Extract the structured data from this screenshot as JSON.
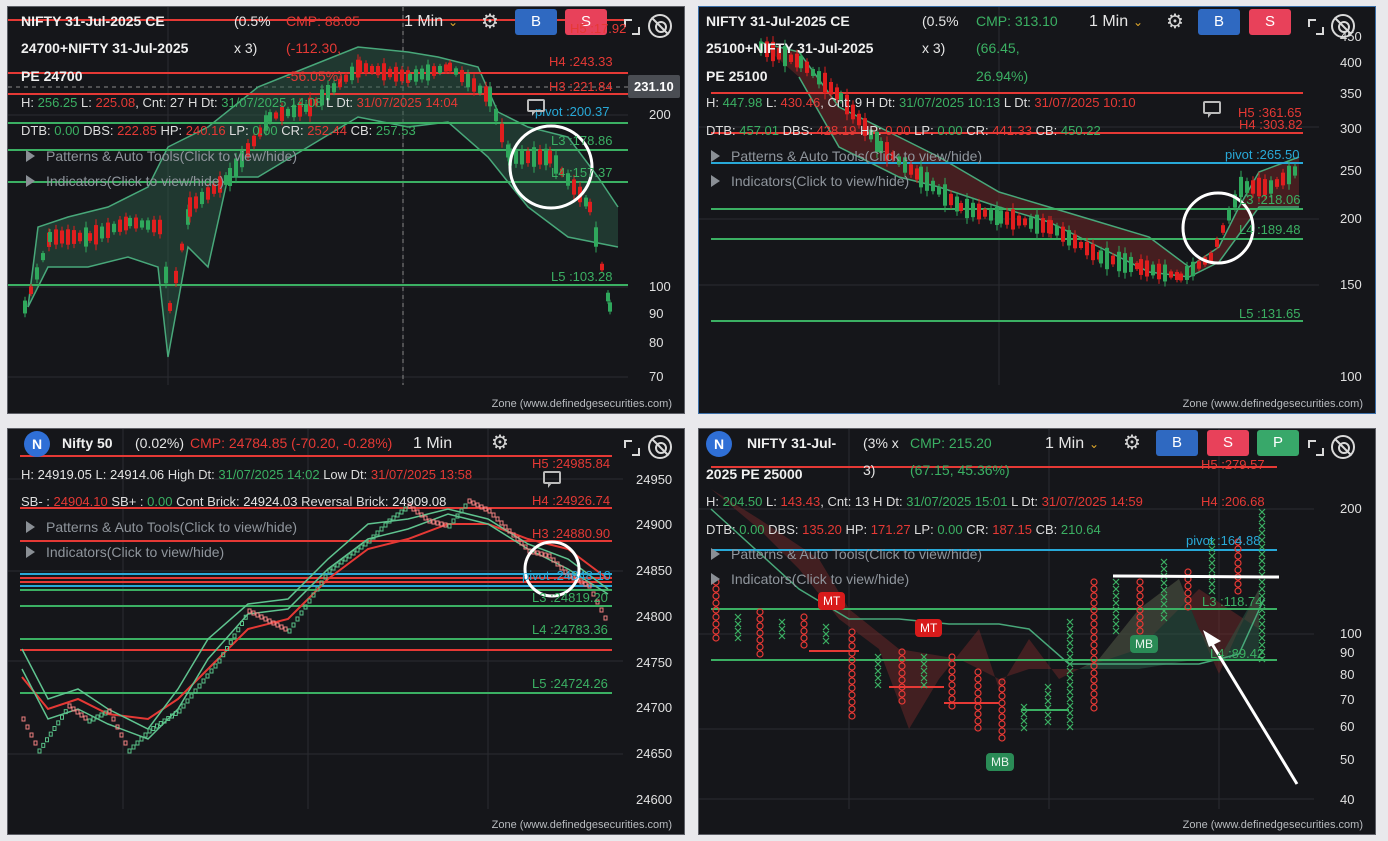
{
  "colors": {
    "bg": "#15161a",
    "green": "#3bb063",
    "red": "#e53935",
    "blue": "#2f69c1",
    "pink": "#e8415a",
    "cyan": "#28a9d8"
  },
  "common": {
    "timeframe": "1 Min",
    "buy_label": "B",
    "sell_label": "S",
    "paper_label": "P",
    "patterns_label": "Patterns & Auto Tools(Click to view/hide)",
    "indicators_label": "Indicators(Click to view/hide)",
    "zone_label": "Zone (www.definedgesecurities.com)",
    "icons": [
      "gear-icon",
      "expand-icon",
      "no-eye-icon",
      "chevron-down-icon",
      "comment-icon"
    ]
  },
  "p1": {
    "title_l1": "NIFTY 31-Jul-2025 CE",
    "title_l2": "24700+NIFTY 31-Jul-2025",
    "title_l3": "PE 24700",
    "pct_l1": "(0.5%",
    "pct_l2": "x 3)",
    "cmp": "CMP: 88.05",
    "chg_l1": "(-112.30,",
    "chg_l2": "-56.05%)",
    "h": "256.25",
    "l": "225.08",
    "cnt": "27",
    "hdt": "31/07/2025 14:08",
    "ldt": "31/07/2025 14:04",
    "dtb": "0.00",
    "dbs": "222.85",
    "hp": "240.16",
    "lp": "0.00",
    "cr": "252.44",
    "cb": "257.53",
    "price_tag": "231.10",
    "levels": {
      "h5": "H5 :17.92",
      "h4": "H4 :243.33",
      "h3": "H3 :221.84",
      "pivot": "pivot :200.37",
      "l3": "L3 :178.86",
      "l4": "L4 :157.37",
      "l5": "L5 :103.28"
    },
    "yaxis": [
      "200",
      "100",
      "90",
      "80",
      "70"
    ]
  },
  "p2": {
    "title_l1": "NIFTY 31-Jul-2025 CE",
    "title_l2": "25100+NIFTY 31-Jul-2025",
    "title_l3": "PE 25100",
    "pct_l1": "(0.5%",
    "pct_l2": "x 3)",
    "cmp": "CMP: 313.10",
    "chg_l1": "(66.45,",
    "chg_l2": "26.94%)",
    "h": "447.98",
    "l": "430.46",
    "cnt": "9",
    "hdt": "31/07/2025 10:13",
    "ldt": "31/07/2025 10:10",
    "dtb": "457.01",
    "dbs": "428.19",
    "hp": "0.00",
    "lp": "0.00",
    "cr": "441.33",
    "cb": "450.22",
    "levels": {
      "h5": "H5 :361.65",
      "h4": "H4 :303.82",
      "pivot": "pivot :265.50",
      "l3": "L3 :218.06",
      "l4": "L4 :189.48",
      "l5": "L5 :131.65"
    },
    "yaxis": [
      "450",
      "400",
      "350",
      "300",
      "250",
      "200",
      "150",
      "100"
    ]
  },
  "p3": {
    "logo": "N",
    "title": "Nifty 50",
    "pct": "(0.02%)",
    "cmp": "CMP: 24784.85 (-70.20, -0.28%)",
    "h": "24919.05",
    "l": "24914.06",
    "hdt": "31/07/2025 14:02",
    "ldt": "31/07/2025 13:58",
    "sbm": "24904.10",
    "sbp": "0.00",
    "cont": "24924.03",
    "rev": "24909.08",
    "levels": {
      "h5": "H5 :24985.84",
      "h4": "H4 :24926.74",
      "h3": "H3 :24880.90",
      "pivot": "pivot :24848.10",
      "l3": "L3 :24819.20",
      "l4": "L4 :24783.36",
      "l5": "L5 :24724.26"
    },
    "yaxis": [
      "24950",
      "24900",
      "24850",
      "24800",
      "24750",
      "24700",
      "24650",
      "24600"
    ]
  },
  "p4": {
    "logo": "N",
    "title_l1": "NIFTY 31-Jul-",
    "title_l2": "2025 PE 25000",
    "pct_l1": "(3% x",
    "pct_l2": "3)",
    "cmp": "CMP: 215.20",
    "chg": "(67.15, 45.36%)",
    "h": "204.50",
    "l": "143.43",
    "cnt": "13",
    "hdt": "31/07/2025 15:01",
    "ldt": "31/07/2025 14:59",
    "dtb": "0.00",
    "dbs": "135.20",
    "hp": "171.27",
    "lp": "0.00",
    "cr": "187.15",
    "cb": "210.64",
    "levels": {
      "h5": "H5 :279.57",
      "h4": "H4 :206.68",
      "pivot": "pivot :164.88",
      "l3": "L3 :118.74",
      "l4": "L4 :89.42"
    },
    "badges": {
      "mt1": "MT",
      "mt2": "MT",
      "mb1": "MB",
      "mb2": "MB"
    },
    "yaxis": [
      "200",
      "100",
      "90",
      "80",
      "70",
      "60",
      "50",
      "40"
    ]
  }
}
